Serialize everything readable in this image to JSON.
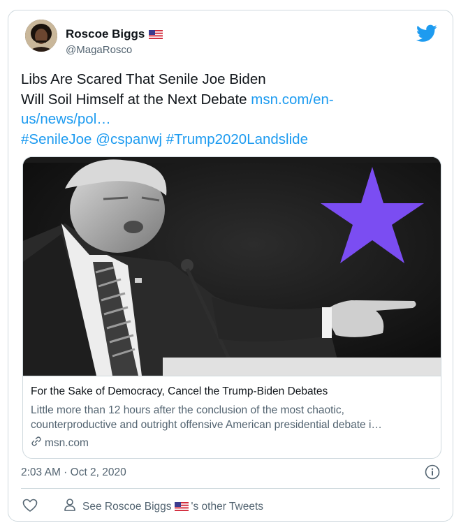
{
  "author": {
    "display_name": "Roscoe Biggs",
    "handle": "@MagaRosco"
  },
  "tweet": {
    "line1": "Libs Are Scared That Senile Joe Biden",
    "line2_text": "Will Soil Himself at the Next Debate ",
    "line2_link": "msn.com/en-",
    "line3_link": "us/news/pol…",
    "hashtag1": "#SenileJoe",
    "mention": "@cspanwj",
    "hashtag2": "#Trump2020Landslide"
  },
  "link_card": {
    "title": "For the Sake of Democracy, Cancel the Trump-Biden Debates",
    "desc_line1": "Little more than 12 hours after the conclusion of the most chaotic,",
    "desc_line2": "counterproductive and outright offensive American presidential debate i…",
    "domain": "msn.com",
    "star_color": "#7b4df2"
  },
  "footer": {
    "timestamp": "2:03 AM · Oct 2, 2020",
    "see_prefix": "See Roscoe Biggs",
    "see_suffix": "'s other Tweets"
  },
  "colors": {
    "link": "#1d9bf0",
    "muted": "#536471",
    "border": "#cfd9de",
    "twitter_blue": "#1d9bf0"
  }
}
